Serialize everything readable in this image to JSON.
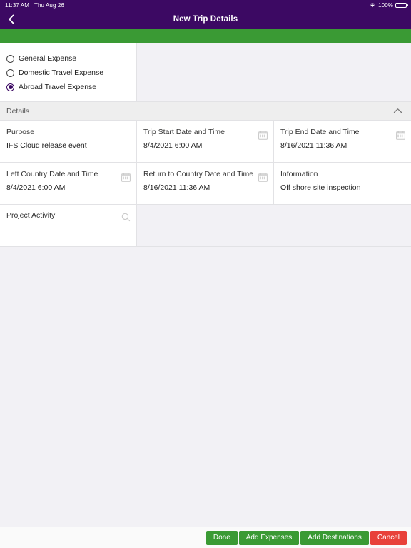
{
  "status_bar": {
    "time": "11:37 AM",
    "date": "Thu Aug 26",
    "battery_percent": "100%",
    "wifi_icon": "wifi-icon",
    "battery_icon": "battery-icon"
  },
  "header": {
    "title": "New Trip Details",
    "back_icon": "back-chevron-icon",
    "menu_icon": "hamburger-menu-icon",
    "background_color": "#3c0963",
    "accent_band_color": "#3a9a34"
  },
  "expense_type": {
    "options": [
      {
        "label": "General Expense",
        "selected": false
      },
      {
        "label": "Domestic Travel Expense",
        "selected": false
      },
      {
        "label": "Abroad Travel Expense",
        "selected": true
      }
    ],
    "selected_color": "#3c0963"
  },
  "details_section": {
    "title": "Details",
    "collapse_icon": "chevron-up-icon",
    "rows": [
      {
        "cells": [
          {
            "label": "Purpose",
            "value": "IFS Cloud release event",
            "icon": null
          },
          {
            "label": "Trip Start Date and Time",
            "value": "8/4/2021 6:00 AM",
            "icon": "calendar-icon"
          },
          {
            "label": "Trip End Date and Time",
            "value": "8/16/2021 11:36 AM",
            "icon": "calendar-icon"
          }
        ]
      },
      {
        "cells": [
          {
            "label": "Left Country Date and Time",
            "value": "8/4/2021 6:00 AM",
            "icon": "calendar-icon"
          },
          {
            "label": "Return to Country Date and Time",
            "value": "8/16/2021 11:36 AM",
            "icon": "calendar-icon"
          },
          {
            "label": "Information",
            "value": "Off shore site inspection",
            "icon": null
          }
        ]
      }
    ],
    "project_activity": {
      "label": "Project Activity",
      "value": "",
      "icon": "search-icon"
    }
  },
  "bottom_bar": {
    "buttons": [
      {
        "label": "Done",
        "style": "green"
      },
      {
        "label": "Add Expenses",
        "style": "green"
      },
      {
        "label": "Add Destinations",
        "style": "green"
      },
      {
        "label": "Cancel",
        "style": "red"
      }
    ],
    "green_color": "#3a9a34",
    "red_color": "#e8413a"
  }
}
